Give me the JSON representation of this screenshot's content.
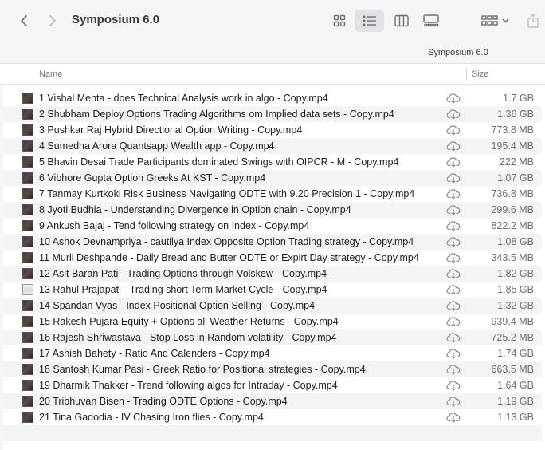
{
  "window": {
    "title": "Symposium 6.0"
  },
  "toolbar": {
    "back_icon": "chevron-left-icon",
    "forward_icon": "chevron-right-icon",
    "views": [
      "icon-view-icon",
      "list-view-icon",
      "column-view-icon",
      "gallery-view-icon"
    ],
    "active_view": "list-view-icon",
    "group_icon": "group-by-icon",
    "share_icon": "share-icon"
  },
  "pathbar": {
    "label": "Symposium 6.0"
  },
  "columns": {
    "name": "Name",
    "size": "Size"
  },
  "files": [
    {
      "name": "1 Vishal Mehta - does Technical Analysis work in algo - Copy.mp4",
      "size": "1.7 GB"
    },
    {
      "name": "2 Shubham Deploy Options Trading Algorithms om Implied data sets - Copy.mp4",
      "size": "1.36 GB"
    },
    {
      "name": "3 Pushkar Raj Hybrid Directional Option Writing - Copy.mp4",
      "size": "773.8 MB"
    },
    {
      "name": "4 Sumedha Arora Quantsapp Wealth app - Copy.mp4",
      "size": "195.4 MB"
    },
    {
      "name": "5 Bhavin Desai Trade Participants dominated Swings with OIPCR - M - Copy.mp4",
      "size": "222 MB"
    },
    {
      "name": "6 Vibhore Gupta  Option  Greeks  At  KST - Copy.mp4",
      "size": "1.07 GB"
    },
    {
      "name": "7 Tanmay Kurtkoki Risk Business Navigating ODTE with 9.20  Precision 1 - Copy.mp4",
      "size": "736.8 MB"
    },
    {
      "name": "8 Jyoti Budhia - Understanding Divergence in Option chain - Copy.mp4",
      "size": "299.6 MB"
    },
    {
      "name": "9 Ankush Bajaj - Tend following strategy on Index - Copy.mp4",
      "size": "822.2 MB"
    },
    {
      "name": "10 Ashok Devnampriya - cautilya Index Opposite Option Trading strategy - Copy.mp4",
      "size": "1.08 GB"
    },
    {
      "name": "11 Murli Deshpande - Daily Bread and Butter ODTE or Expirt Day strategy - Copy.mp4",
      "size": "343.5 MB"
    },
    {
      "name": "12  Asit Baran Pati - Trading Options through Volskew - Copy.mp4",
      "size": "1.82 GB"
    },
    {
      "name": "13  Rahul Prajapati - Trading short Term Market Cycle - Copy.mp4",
      "size": "1.85 GB",
      "thumb": "light"
    },
    {
      "name": "14 Spandan Vyas - Index Positional Option Selling - Copy.mp4",
      "size": "1.32 GB"
    },
    {
      "name": "15 Rakesh Pujara Equity + Options all Weather Returns - Copy.mp4",
      "size": "939.4 MB"
    },
    {
      "name": "16 Rajesh Shriwastava - Stop Loss in Random volatility - Copy.mp4",
      "size": "725.2 MB"
    },
    {
      "name": "17 Ashish Bahety - Ratio And Calenders - Copy.mp4",
      "size": "1.74 GB"
    },
    {
      "name": "18 Santosh Kumar Pasi - Greek Ratio for Positional strategies - Copy.mp4",
      "size": "663.5 MB"
    },
    {
      "name": "19 Dharmik Thakker - Trend following algos for Intraday - Copy.mp4",
      "size": "1.64 GB"
    },
    {
      "name": "20 Tribhuvan Bisen - Trading ODTE Options - Copy.mp4",
      "size": "1.19 GB"
    },
    {
      "name": "21 Tina Gadodia - IV Chasing Iron flies - Copy.mp4",
      "size": "1.13 GB"
    }
  ]
}
